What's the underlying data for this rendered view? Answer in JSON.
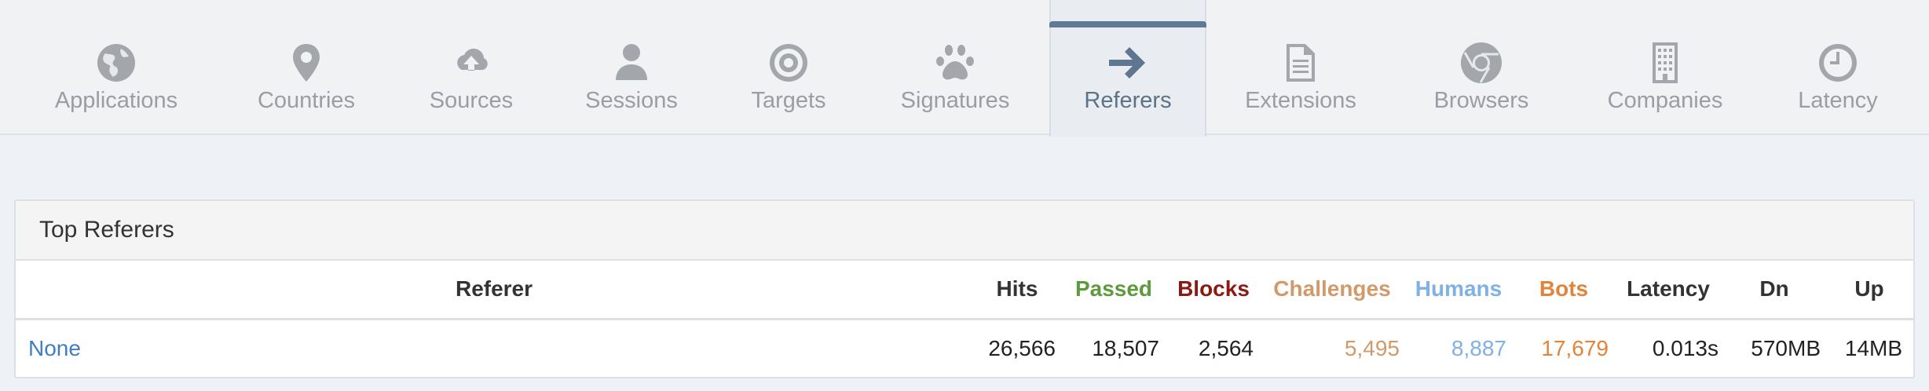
{
  "tabs": [
    {
      "label": "Applications",
      "icon": "globe-icon",
      "active": false
    },
    {
      "label": "Countries",
      "icon": "map-pin-icon",
      "active": false
    },
    {
      "label": "Sources",
      "icon": "cloud-upload-icon",
      "active": false
    },
    {
      "label": "Sessions",
      "icon": "user-icon",
      "active": false
    },
    {
      "label": "Targets",
      "icon": "target-icon",
      "active": false
    },
    {
      "label": "Signatures",
      "icon": "paw-icon",
      "active": false
    },
    {
      "label": "Referers",
      "icon": "arrow-right-icon",
      "active": true
    },
    {
      "label": "Extensions",
      "icon": "file-icon",
      "active": false
    },
    {
      "label": "Browsers",
      "icon": "chrome-icon",
      "active": false
    },
    {
      "label": "Companies",
      "icon": "building-icon",
      "active": false
    },
    {
      "label": "Latency",
      "icon": "clock-icon",
      "active": false
    }
  ],
  "colors": {
    "active_accent": "#5f7a95",
    "passed": "#5c9a3c",
    "blocks": "#8c1a12",
    "challenges": "#d29a6a",
    "humans": "#7fb0e6",
    "bots": "#e2843a",
    "link": "#3f7fc1"
  },
  "panel": {
    "title": "Top Referers",
    "columns": {
      "referer": "Referer",
      "hits": "Hits",
      "passed": "Passed",
      "blocks": "Blocks",
      "challenges": "Challenges",
      "humans": "Humans",
      "bots": "Bots",
      "latency": "Latency",
      "dn": "Dn",
      "up": "Up"
    },
    "rows": [
      {
        "referer": "None",
        "hits": "26,566",
        "passed": "18,507",
        "blocks": "2,564",
        "challenges": "5,495",
        "humans": "8,887",
        "bots": "17,679",
        "latency": "0.013s",
        "dn": "570MB",
        "up": "14MB"
      }
    ]
  }
}
